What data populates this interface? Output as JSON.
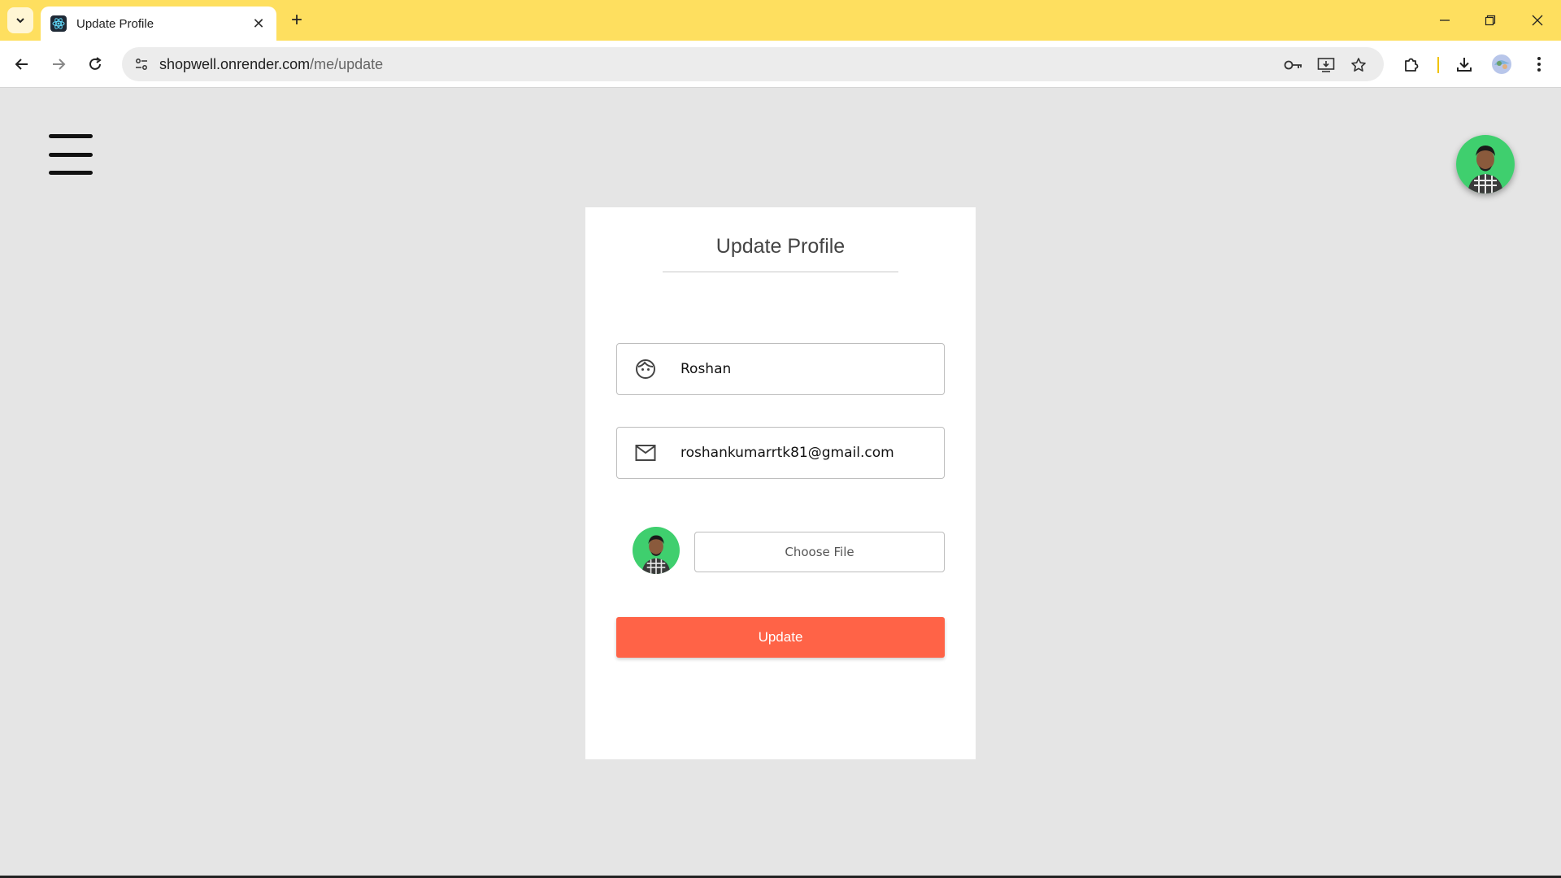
{
  "browser": {
    "tab_title": "Update Profile",
    "url_host": "shopwell.onrender.com",
    "url_path": "/me/update",
    "accent_color": "#fedf5f"
  },
  "page": {
    "title": "Update Profile",
    "name_value": "Roshan",
    "email_value": "roshankumarrtk81@gmail.com",
    "choose_file_label": "Choose File",
    "update_label": "Update",
    "button_color": "#ff6347",
    "avatar_bg_color": "#3fcf6e"
  },
  "icons": {
    "menu": "hamburger-menu-icon",
    "name": "face-icon",
    "email": "mail-icon"
  }
}
